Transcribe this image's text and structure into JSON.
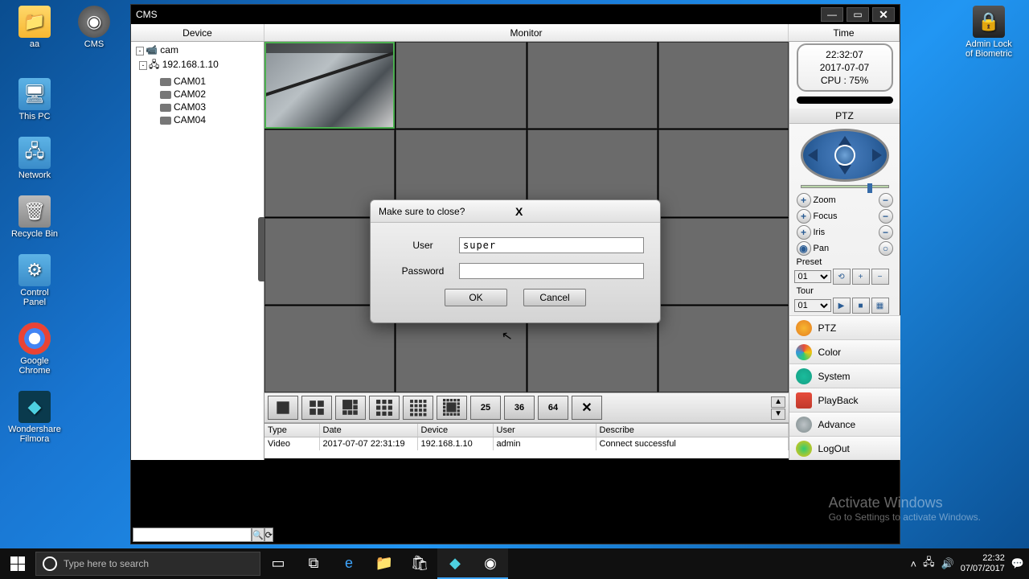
{
  "desktop": {
    "left_icons": [
      {
        "id": "aa",
        "label": "aa"
      },
      {
        "id": "cms",
        "label": "CMS"
      },
      {
        "id": "thispc",
        "label": "This PC"
      },
      {
        "id": "network",
        "label": "Network"
      },
      {
        "id": "recycle",
        "label": "Recycle Bin"
      },
      {
        "id": "cpanel",
        "label": "Control Panel"
      },
      {
        "id": "chrome",
        "label": "Google Chrome"
      },
      {
        "id": "filmora",
        "label": "Wondershare Filmora"
      }
    ],
    "right_icon": {
      "label": "Admin Lock of Biometric"
    }
  },
  "app": {
    "title": "CMS",
    "tabs": {
      "device": "Device",
      "monitor": "Monitor",
      "time": "Time"
    }
  },
  "tree": {
    "root": "cam",
    "ip": "192.168.1.10",
    "cams": [
      "CAM01",
      "CAM02",
      "CAM03",
      "CAM04"
    ]
  },
  "time_panel": {
    "time": "22:32:07",
    "date": "2017-07-07",
    "cpu": "CPU : 75%"
  },
  "ptz": {
    "title": "PTZ",
    "rows": [
      {
        "label": "Zoom"
      },
      {
        "label": "Focus"
      },
      {
        "label": "Iris"
      },
      {
        "label": "Pan"
      }
    ],
    "preset_label": "Preset",
    "preset_value": "01",
    "tour_label": "Tour",
    "tour_value": "01"
  },
  "side_menu": [
    {
      "k": "ptz",
      "label": "PTZ"
    },
    {
      "k": "color",
      "label": "Color"
    },
    {
      "k": "system",
      "label": "System"
    },
    {
      "k": "playback",
      "label": "PlayBack"
    },
    {
      "k": "advance",
      "label": "Advance"
    },
    {
      "k": "logout",
      "label": "LogOut"
    }
  ],
  "layout_btns": [
    "1",
    "4",
    "9",
    "16",
    "25g",
    "36g",
    "25",
    "36",
    "64"
  ],
  "log": {
    "headers": {
      "type": "Type",
      "date": "Date",
      "device": "Device",
      "user": "User",
      "describe": "Describe"
    },
    "row": {
      "type": "Video",
      "date": "2017-07-07 22:31:19",
      "device": "192.168.1.10",
      "user": "admin",
      "describe": "Connect successful"
    }
  },
  "dialog": {
    "title": "Make sure to close?",
    "user_label": "User",
    "user_value": "super",
    "password_label": "Password",
    "password_value": "",
    "ok": "OK",
    "cancel": "Cancel"
  },
  "watermark": {
    "title": "Activate Windows",
    "sub": "Go to Settings to activate Windows."
  },
  "taskbar": {
    "search_placeholder": "Type here to search",
    "clock_time": "22:32",
    "clock_date": "07/07/2017"
  }
}
